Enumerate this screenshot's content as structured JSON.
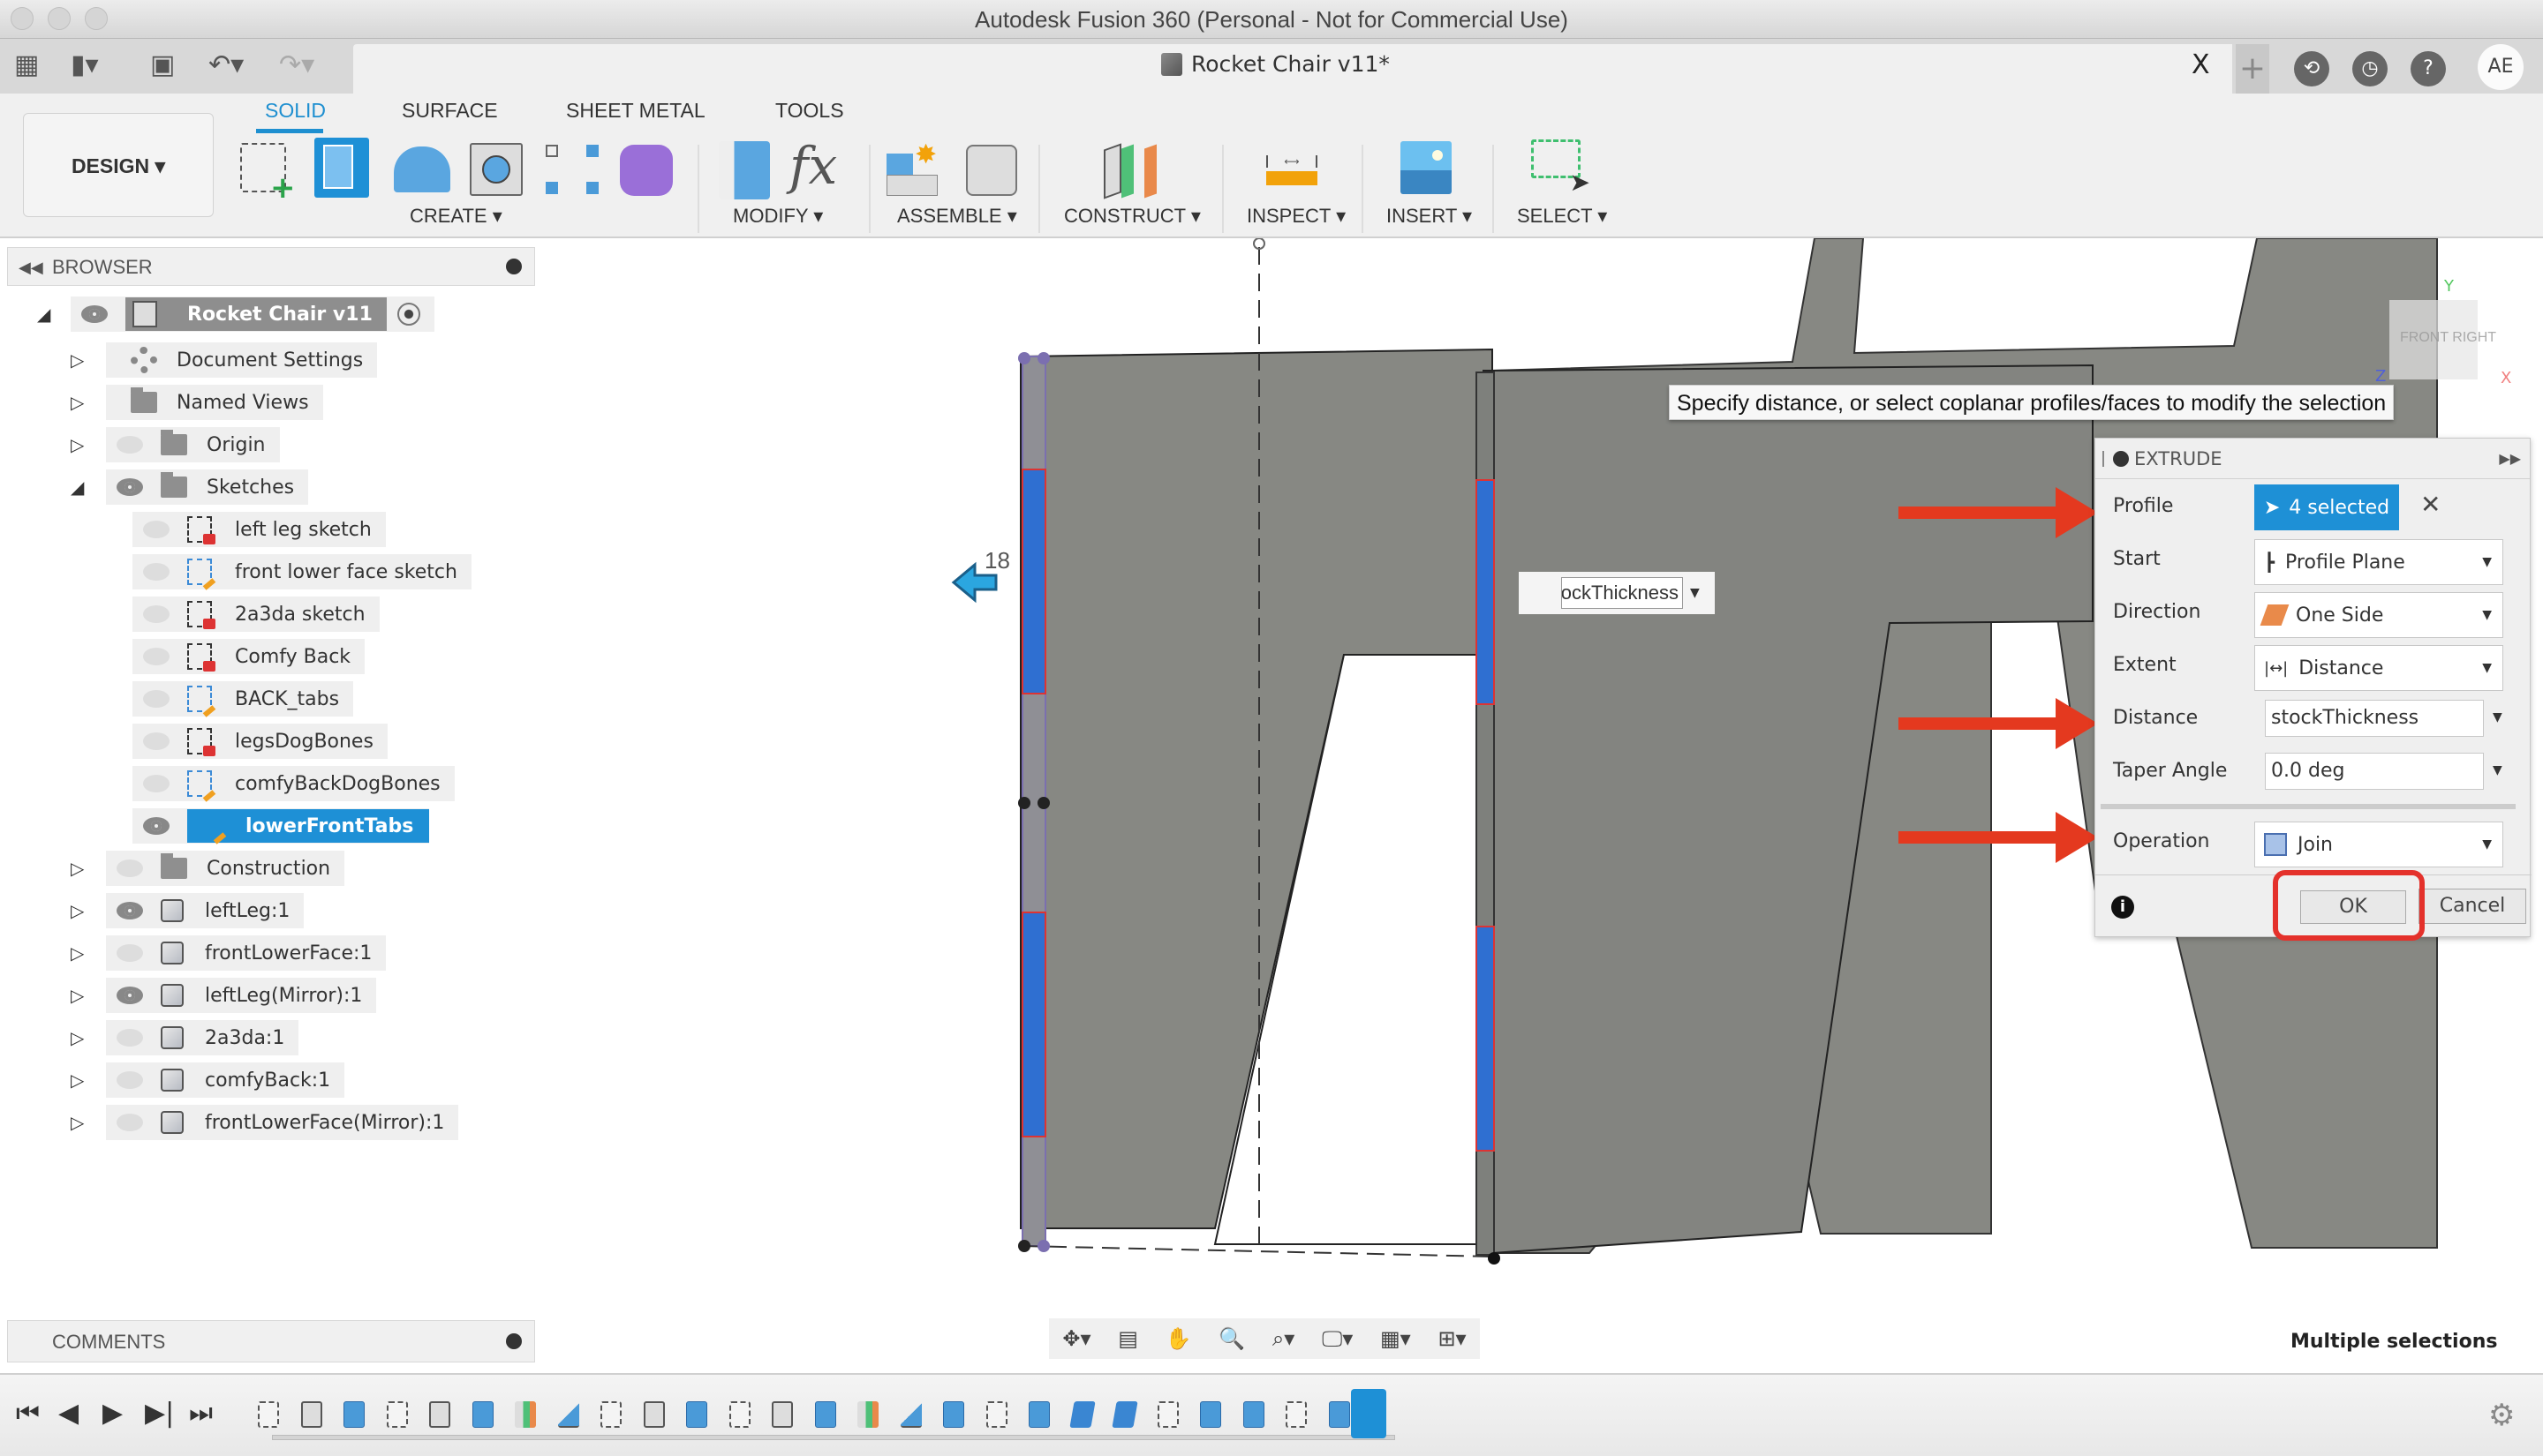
{
  "window": {
    "title": "Autodesk Fusion 360 (Personal - Not for Commercial Use)"
  },
  "document": {
    "title": "Rocket Chair v11*",
    "close_label": "X",
    "user_initials": "AE"
  },
  "workspace": {
    "label": "DESIGN ▾"
  },
  "ribbon": {
    "tabs": [
      {
        "label": "SOLID",
        "active": true
      },
      {
        "label": "SURFACE",
        "active": false
      },
      {
        "label": "SHEET METAL",
        "active": false
      },
      {
        "label": "TOOLS",
        "active": false
      }
    ],
    "groups": [
      {
        "label": "CREATE ▾",
        "tools": [
          "create-sketch",
          "extrude",
          "revolve",
          "hole",
          "pattern",
          "create-form"
        ]
      },
      {
        "label": "MODIFY ▾",
        "tools": [
          "press-pull",
          "change-parameters"
        ]
      },
      {
        "label": "ASSEMBLE ▾",
        "tools": [
          "new-component",
          "joint"
        ]
      },
      {
        "label": "CONSTRUCT ▾",
        "tools": [
          "offset-plane"
        ]
      },
      {
        "label": "INSPECT ▾",
        "tools": [
          "measure"
        ]
      },
      {
        "label": "INSERT ▾",
        "tools": [
          "insert-image"
        ]
      },
      {
        "label": "SELECT ▾",
        "tools": [
          "select"
        ]
      }
    ]
  },
  "browser": {
    "title": "BROWSER",
    "root": "Rocket Chair v11",
    "items": [
      {
        "label": "Document Settings",
        "icon": "gear",
        "level": 1,
        "expander": "collapsed",
        "visible": null
      },
      {
        "label": "Named Views",
        "icon": "folder",
        "level": 1,
        "expander": "collapsed",
        "visible": null
      },
      {
        "label": "Origin",
        "icon": "folder",
        "level": 1,
        "expander": "collapsed",
        "visible": false
      },
      {
        "label": "Sketches",
        "icon": "folder",
        "level": 1,
        "expander": "expanded",
        "visible": true
      },
      {
        "label": "left leg sketch",
        "icon": "sketch-locked",
        "level": 2,
        "visible": false
      },
      {
        "label": "front lower face sketch",
        "icon": "sketch-edit",
        "level": 2,
        "visible": false
      },
      {
        "label": "2a3da sketch",
        "icon": "sketch-locked",
        "level": 2,
        "visible": false
      },
      {
        "label": "Comfy Back",
        "icon": "sketch-locked",
        "level": 2,
        "visible": false
      },
      {
        "label": "BACK_tabs",
        "icon": "sketch-edit",
        "level": 2,
        "visible": false
      },
      {
        "label": "legsDogBones",
        "icon": "sketch-locked",
        "level": 2,
        "visible": false
      },
      {
        "label": "comfyBackDogBones",
        "icon": "sketch-edit",
        "level": 2,
        "visible": false
      },
      {
        "label": "lowerFrontTabs",
        "icon": "sketch-edit",
        "level": 2,
        "visible": true,
        "selected": true
      },
      {
        "label": "Construction",
        "icon": "folder",
        "level": 1,
        "expander": "collapsed",
        "visible": false
      },
      {
        "label": "leftLeg:1",
        "icon": "body",
        "level": 1,
        "expander": "collapsed",
        "visible": true
      },
      {
        "label": "frontLowerFace:1",
        "icon": "body",
        "level": 1,
        "expander": "collapsed",
        "visible": false
      },
      {
        "label": "leftLeg(Mirror):1",
        "icon": "body",
        "level": 1,
        "expander": "collapsed",
        "visible": true
      },
      {
        "label": "2a3da:1",
        "icon": "body",
        "level": 1,
        "expander": "collapsed",
        "visible": false
      },
      {
        "label": "comfyBack:1",
        "icon": "body",
        "level": 1,
        "expander": "collapsed",
        "visible": false
      },
      {
        "label": "frontLowerFace(Mirror):1",
        "icon": "body",
        "level": 1,
        "expander": "collapsed",
        "visible": false
      }
    ]
  },
  "comments": {
    "title": "COMMENTS"
  },
  "viewport": {
    "tooltip": "Specify distance, or select coplanar profiles/faces to modify the selection",
    "inline_distance": "stockThickness",
    "dimension_label": "18",
    "viewcube": {
      "front": "FRONT",
      "right": "RIGHT",
      "axes": [
        "Y",
        "Z",
        "X"
      ]
    }
  },
  "extrude": {
    "title": "EXTRUDE",
    "fields": [
      {
        "label": "Profile",
        "value": "4 selected",
        "type": "selection"
      },
      {
        "label": "Start",
        "value": "Profile Plane",
        "type": "select",
        "icon": "profile-plane"
      },
      {
        "label": "Direction",
        "value": "One Side",
        "type": "select",
        "icon": "one-side"
      },
      {
        "label": "Extent",
        "value": "Distance",
        "type": "select",
        "icon": "distance"
      },
      {
        "label": "Distance",
        "value": "stockThickness",
        "type": "input"
      },
      {
        "label": "Taper Angle",
        "value": "0.0 deg",
        "type": "input"
      },
      {
        "label": "Operation",
        "value": "Join",
        "type": "select",
        "icon": "join"
      }
    ],
    "ok_label": "OK",
    "cancel_label": "Cancel",
    "clear_label": "✕"
  },
  "annotations": {
    "arrow_color": "#e4391f",
    "highlight_color": "#e4312b"
  },
  "status": {
    "text": "Multiple selections"
  },
  "timeline": {
    "features": [
      "sketch",
      "body",
      "extrude",
      "sketch",
      "body",
      "extrude",
      "plane",
      "mirror",
      "sketch",
      "body",
      "extrude",
      "sketch",
      "body",
      "extrude",
      "plane",
      "mirror",
      "extrude",
      "sketch",
      "extrude",
      "combine",
      "combine",
      "sketch",
      "extrude",
      "extrude",
      "sketch",
      "extrude"
    ],
    "active_feature": "sketch"
  },
  "colors": {
    "accent": "#1e90d6",
    "model_gray": "#878883",
    "profile_blue": "#2f6fd1"
  }
}
